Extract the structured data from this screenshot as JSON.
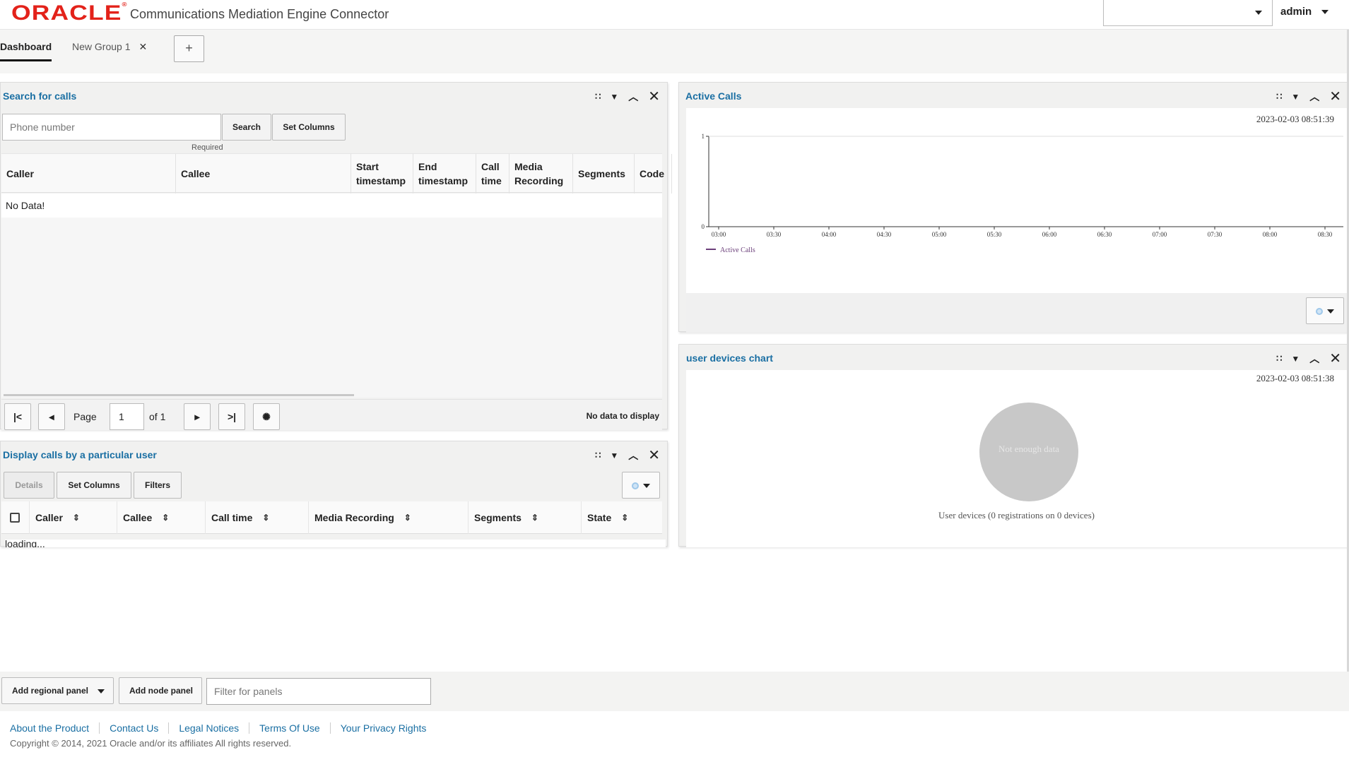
{
  "header": {
    "logo": "ORACLE",
    "logo_mark": "®",
    "app_title": "Communications Mediation Engine Connector",
    "selector_value": "",
    "user": "admin"
  },
  "tabs": [
    {
      "label": "Dashboard",
      "active": true
    },
    {
      "label": "New Group 1",
      "closable": true
    }
  ],
  "add_tab_label": "+",
  "search_panel": {
    "title": "Search for calls",
    "phone_placeholder": "Phone number",
    "search_label": "Search",
    "set_columns_label": "Set Columns",
    "required_label": "Required",
    "columns": [
      "Caller",
      "Callee",
      "Start timestamp",
      "End timestamp",
      "Call time",
      "Media Recording",
      "Segments",
      "Code"
    ],
    "empty_message": "No Data!",
    "pager": {
      "page_label": "Page",
      "page_value": "1",
      "of_label": "of 1",
      "status": "No data to display"
    }
  },
  "display_panel": {
    "title": "Display calls by a particular user",
    "details_label": "Details",
    "set_columns_label": "Set Columns",
    "filters_label": "Filters",
    "columns": [
      "Caller",
      "Callee",
      "Call time",
      "Media Recording",
      "Segments",
      "State"
    ],
    "loading_text": "loading..."
  },
  "active_calls_panel": {
    "title": "Active Calls",
    "timestamp": "2023-02-03 08:51:39"
  },
  "chart_data": {
    "type": "line",
    "title": "",
    "xlabel": "",
    "ylabel": "",
    "x": [
      "03:00",
      "03:30",
      "04:00",
      "04:30",
      "05:00",
      "05:30",
      "06:00",
      "06:30",
      "07:00",
      "07:30",
      "08:00",
      "08:30"
    ],
    "series": [
      {
        "name": "Active Calls",
        "values": [],
        "color": "#6b3f7a"
      }
    ],
    "ylim": [
      0,
      1
    ],
    "yticks": [
      "1",
      "0"
    ],
    "legend": "bottom-left",
    "grid": false
  },
  "devices_panel": {
    "title": "user devices chart",
    "timestamp": "2023-02-03 08:51:38",
    "pie_text": "Not enough data",
    "caption": "User devices (0 registrations on 0 devices)"
  },
  "bottom": {
    "add_regional_label": "Add regional panel",
    "add_node_label": "Add node panel",
    "filter_placeholder": "Filter for panels"
  },
  "footer": {
    "links": [
      "About the Product",
      "Contact Us",
      "Legal Notices",
      "Terms Of Use",
      "Your Privacy Rights"
    ],
    "copyright": "Copyright © 2014, 2021 Oracle and/or its affiliates All rights reserved."
  },
  "colors": {
    "brand": "#e3221a",
    "link": "#1a6fa3",
    "series": "#6b3f7a"
  }
}
